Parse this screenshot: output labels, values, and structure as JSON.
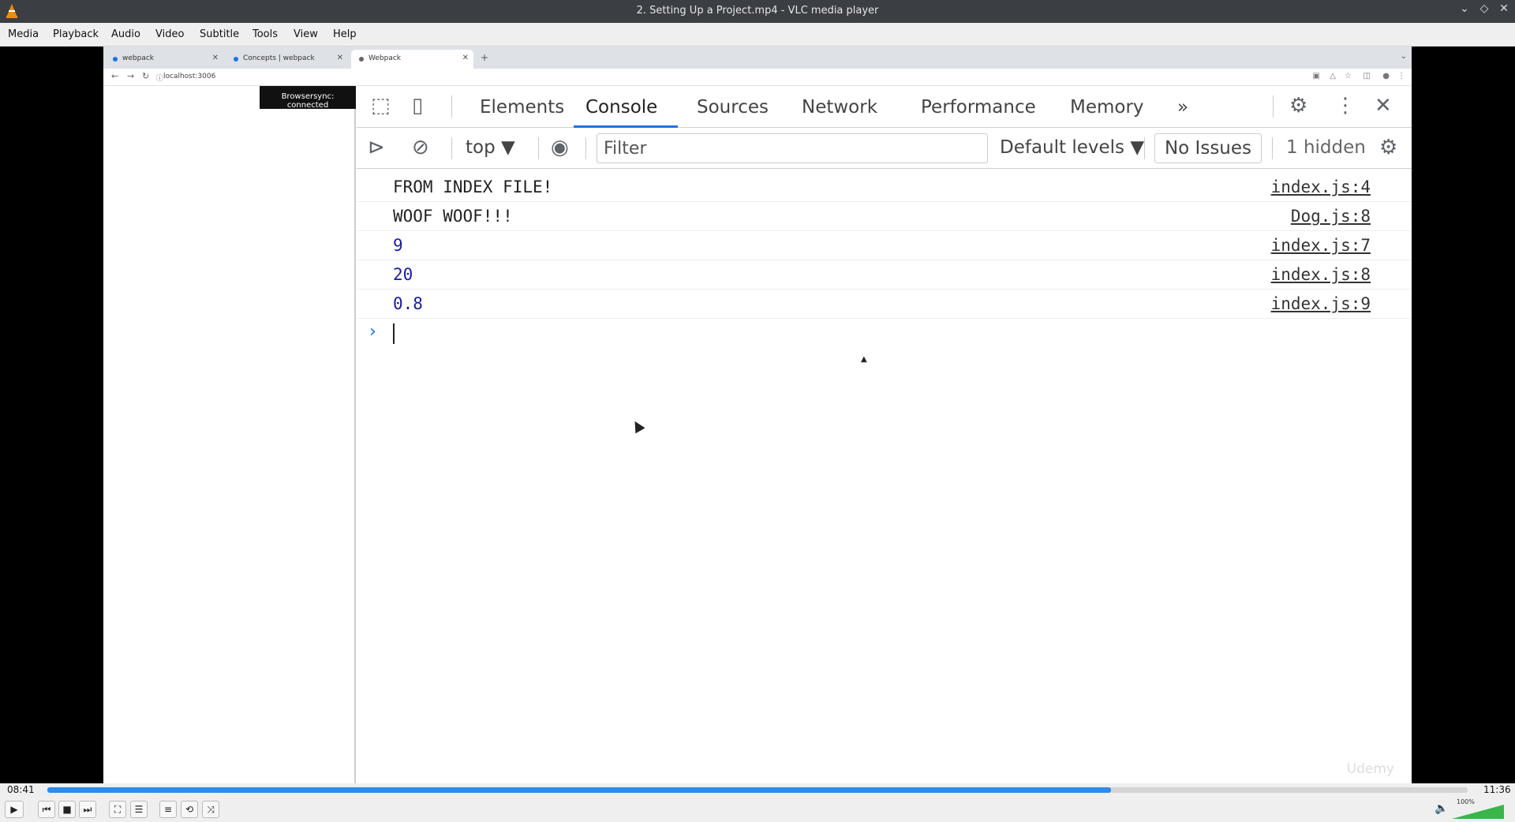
{
  "window": {
    "title": "2. Setting Up a Project.mp4 - VLC media player",
    "controls": [
      "minimize-icon",
      "maximize-icon",
      "close-icon"
    ]
  },
  "menu": [
    "Media",
    "Playback",
    "Audio",
    "Video",
    "Subtitle",
    "Tools",
    "View",
    "Help"
  ],
  "browser": {
    "tabs": [
      {
        "label": "webpack"
      },
      {
        "label": "Concepts | webpack"
      },
      {
        "label": "Webpack"
      }
    ],
    "url": "localhost:3006",
    "badge": "Browsersync: connected"
  },
  "devtools": {
    "tabs": [
      "Elements",
      "Console",
      "Sources",
      "Network",
      "Performance",
      "Memory"
    ],
    "active_tab": "Console",
    "more_tabs": "»",
    "context": "top ▼",
    "filter_placeholder": "Filter",
    "levels": "Default levels ▼",
    "issues": "No Issues",
    "hidden": "1 hidden",
    "logs": [
      {
        "message": "FROM INDEX FILE!",
        "source": "index.js:4",
        "numeric": false
      },
      {
        "message": "WOOF WOOF!!!",
        "source": "Dog.js:8",
        "numeric": false
      },
      {
        "message": "9",
        "source": "index.js:7",
        "numeric": true
      },
      {
        "message": "20",
        "source": "index.js:8",
        "numeric": true
      },
      {
        "message": "0.8",
        "source": "index.js:9",
        "numeric": true
      }
    ],
    "prompt": "›"
  },
  "watermark": "Udemy",
  "player": {
    "elapsed": "08:41",
    "total": "11:36",
    "progress": 0.749,
    "volume_label": "100%",
    "volume": 1.0
  }
}
